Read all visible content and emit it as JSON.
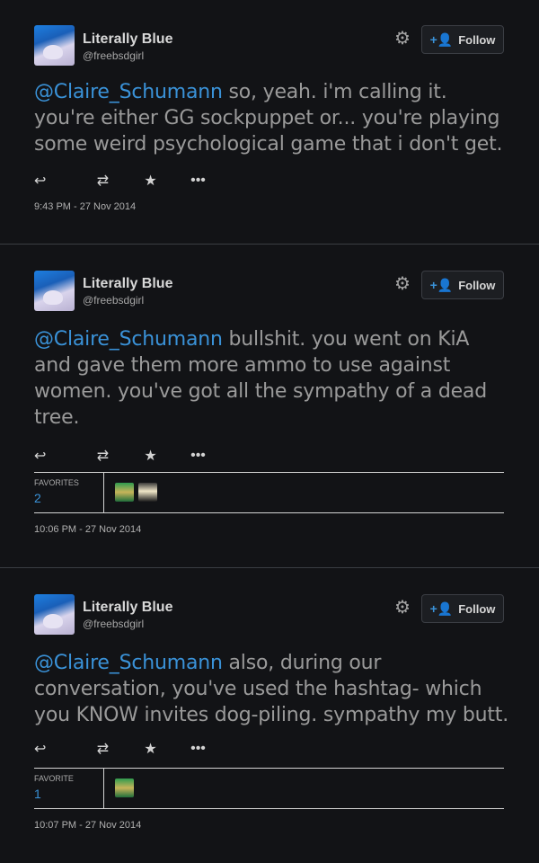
{
  "icons": {
    "settings": "gear-icon",
    "follow": "add-person-icon",
    "reply": "reply-icon",
    "retweet": "retweet-icon",
    "favorite": "star-icon",
    "more": "more-icon"
  },
  "colors": {
    "accent": "#3a92d8",
    "background": "#121316"
  },
  "tweets": [
    {
      "author": {
        "name": "Literally Blue",
        "handle": "@freebsdgirl"
      },
      "follow_label": "Follow",
      "mention": "@Claire_Schumann",
      "body": " so, yeah. i'm calling it. you're either GG sockpuppet or... you're playing some weird psychological game that i don't get.",
      "timestamp": "9:43 PM - 27 Nov 2014"
    },
    {
      "author": {
        "name": "Literally Blue",
        "handle": "@freebsdgirl"
      },
      "follow_label": "Follow",
      "mention": "@Claire_Schumann",
      "body": " bullshit. you went on KiA and gave them more ammo to use against women. you've got all the sympathy of a dead tree.",
      "favorites_label": "FAVORITES",
      "favorites_count": "2",
      "timestamp": "10:06 PM - 27 Nov 2014"
    },
    {
      "author": {
        "name": "Literally Blue",
        "handle": "@freebsdgirl"
      },
      "follow_label": "Follow",
      "mention": "@Claire_Schumann",
      "body": " also, during our conversation, you've used the hashtag- which you KNOW invites dog-piling. sympathy my butt.",
      "favorites_label": "FAVORITE",
      "favorites_count": "1",
      "timestamp": "10:07 PM - 27 Nov 2014"
    }
  ]
}
